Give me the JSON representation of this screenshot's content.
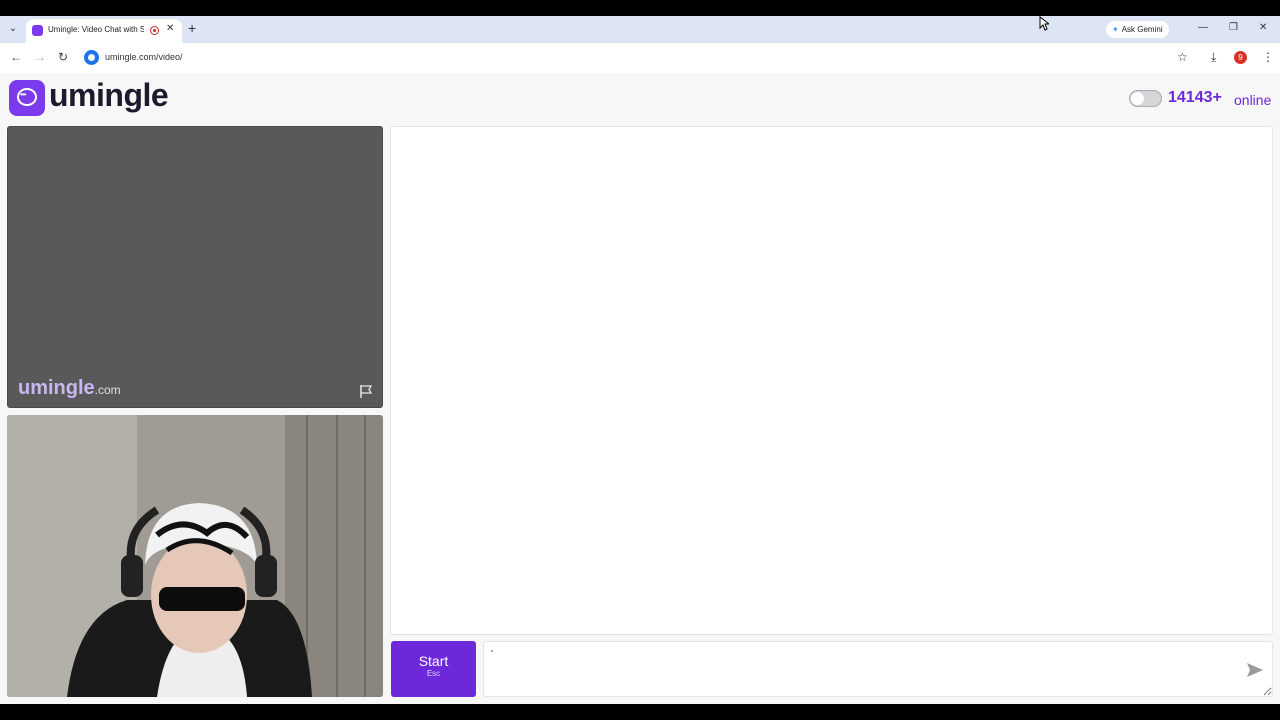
{
  "browser": {
    "tab_title": "Umingle: Video Chat with S",
    "close_tab_glyph": "✕",
    "new_tab_glyph": "+",
    "ask_gemini": "Ask Gemini",
    "url": "umingle.com/video/",
    "profile_initial": "9"
  },
  "site": {
    "logo_text": "umingle",
    "online_count": "14143+",
    "online_label": "online",
    "brand_color": "#6d28d9"
  },
  "stranger_video": {
    "watermark": "umingle",
    "watermark_tld": ".com"
  },
  "controls": {
    "start_label": "Start",
    "start_shortcut": "Esc",
    "message_value": "`"
  },
  "icons": [
    "tab-dropdown-icon",
    "favicon-icon",
    "recording-icon",
    "close-icon",
    "plus-icon",
    "gemini-sparkle-icon",
    "minimize-icon",
    "restore-icon",
    "back-icon",
    "forward-icon",
    "reload-icon",
    "site-info-icon",
    "star-icon",
    "download-icon",
    "menu-icon",
    "logo-chat-icon",
    "flag-icon",
    "send-icon",
    "cursor-icon"
  ]
}
